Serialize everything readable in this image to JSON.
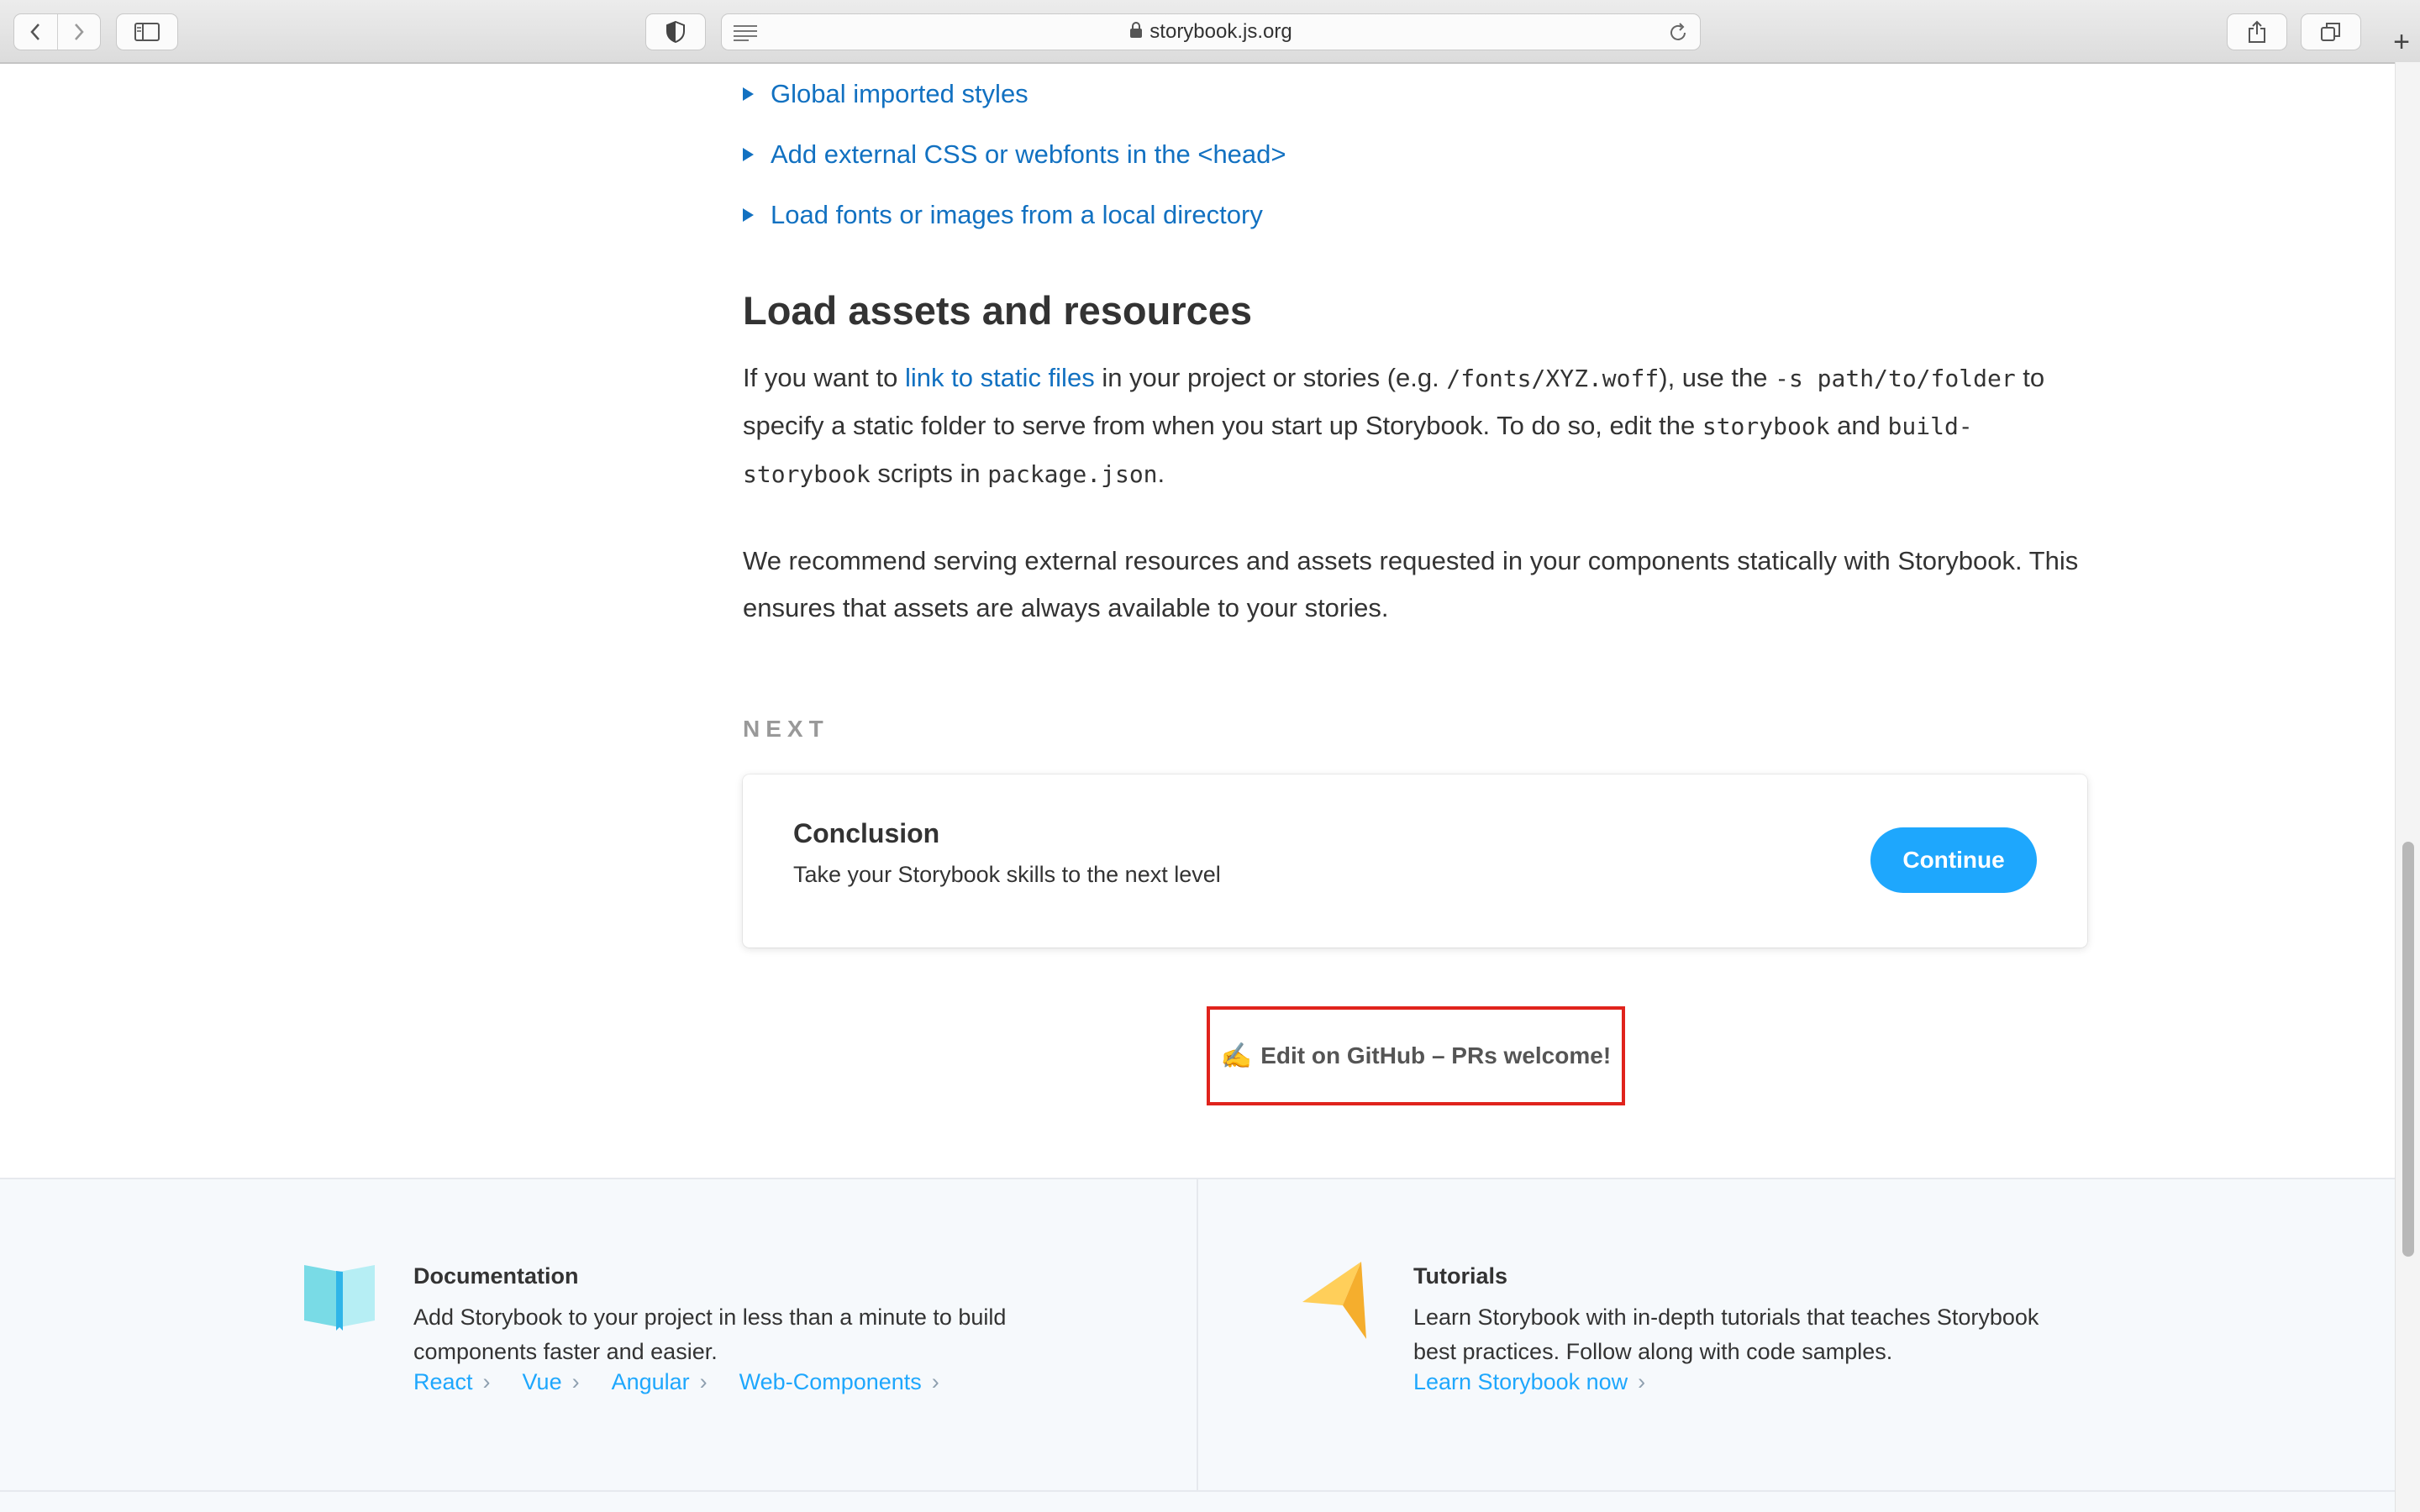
{
  "browser": {
    "url": "storybook.js.org",
    "new_tab_label": "+"
  },
  "toggles": [
    "Global imported styles",
    "Add external CSS or webfonts in the <head>",
    "Load fonts or images from a local directory"
  ],
  "section": {
    "title": "Load assets and resources",
    "p1": {
      "t1": "If you want to ",
      "link": "link to static files",
      "t2": " in your project or stories (e.g. ",
      "c1": "/fonts/XYZ.woff",
      "t3": "), use the ",
      "c2": "-s path/to/folder",
      "t4": " to specify a static folder to serve from when you start up Storybook. To do so, edit the ",
      "c3": "storybook",
      "t5": " and ",
      "c4": "build-storybook",
      "t6": " scripts in ",
      "c5": "package.json",
      "t7": "."
    },
    "p2": "We recommend serving external resources and assets requested in your components statically with Storybook. This ensures that assets are always available to your stories."
  },
  "next": {
    "label": "NEXT",
    "title": "Conclusion",
    "description": "Take your Storybook skills to the next level",
    "button": "Continue"
  },
  "edit": {
    "emoji": "✍️",
    "label": "Edit on GitHub – PRs welcome!"
  },
  "footer": {
    "docs": {
      "title": "Documentation",
      "description": "Add Storybook to your project in less than a minute to build components faster and easier.",
      "links": [
        "React",
        "Vue",
        "Angular",
        "Web-Components"
      ]
    },
    "tutorials": {
      "title": "Tutorials",
      "description": "Learn Storybook with in-depth tutorials that teaches Storybook best practices. Follow along with code samples.",
      "link": "Learn Storybook now"
    }
  },
  "colors": {
    "link": "#1271c1",
    "accent": "#1ea7fd",
    "highlight_box": "#e0231c"
  }
}
